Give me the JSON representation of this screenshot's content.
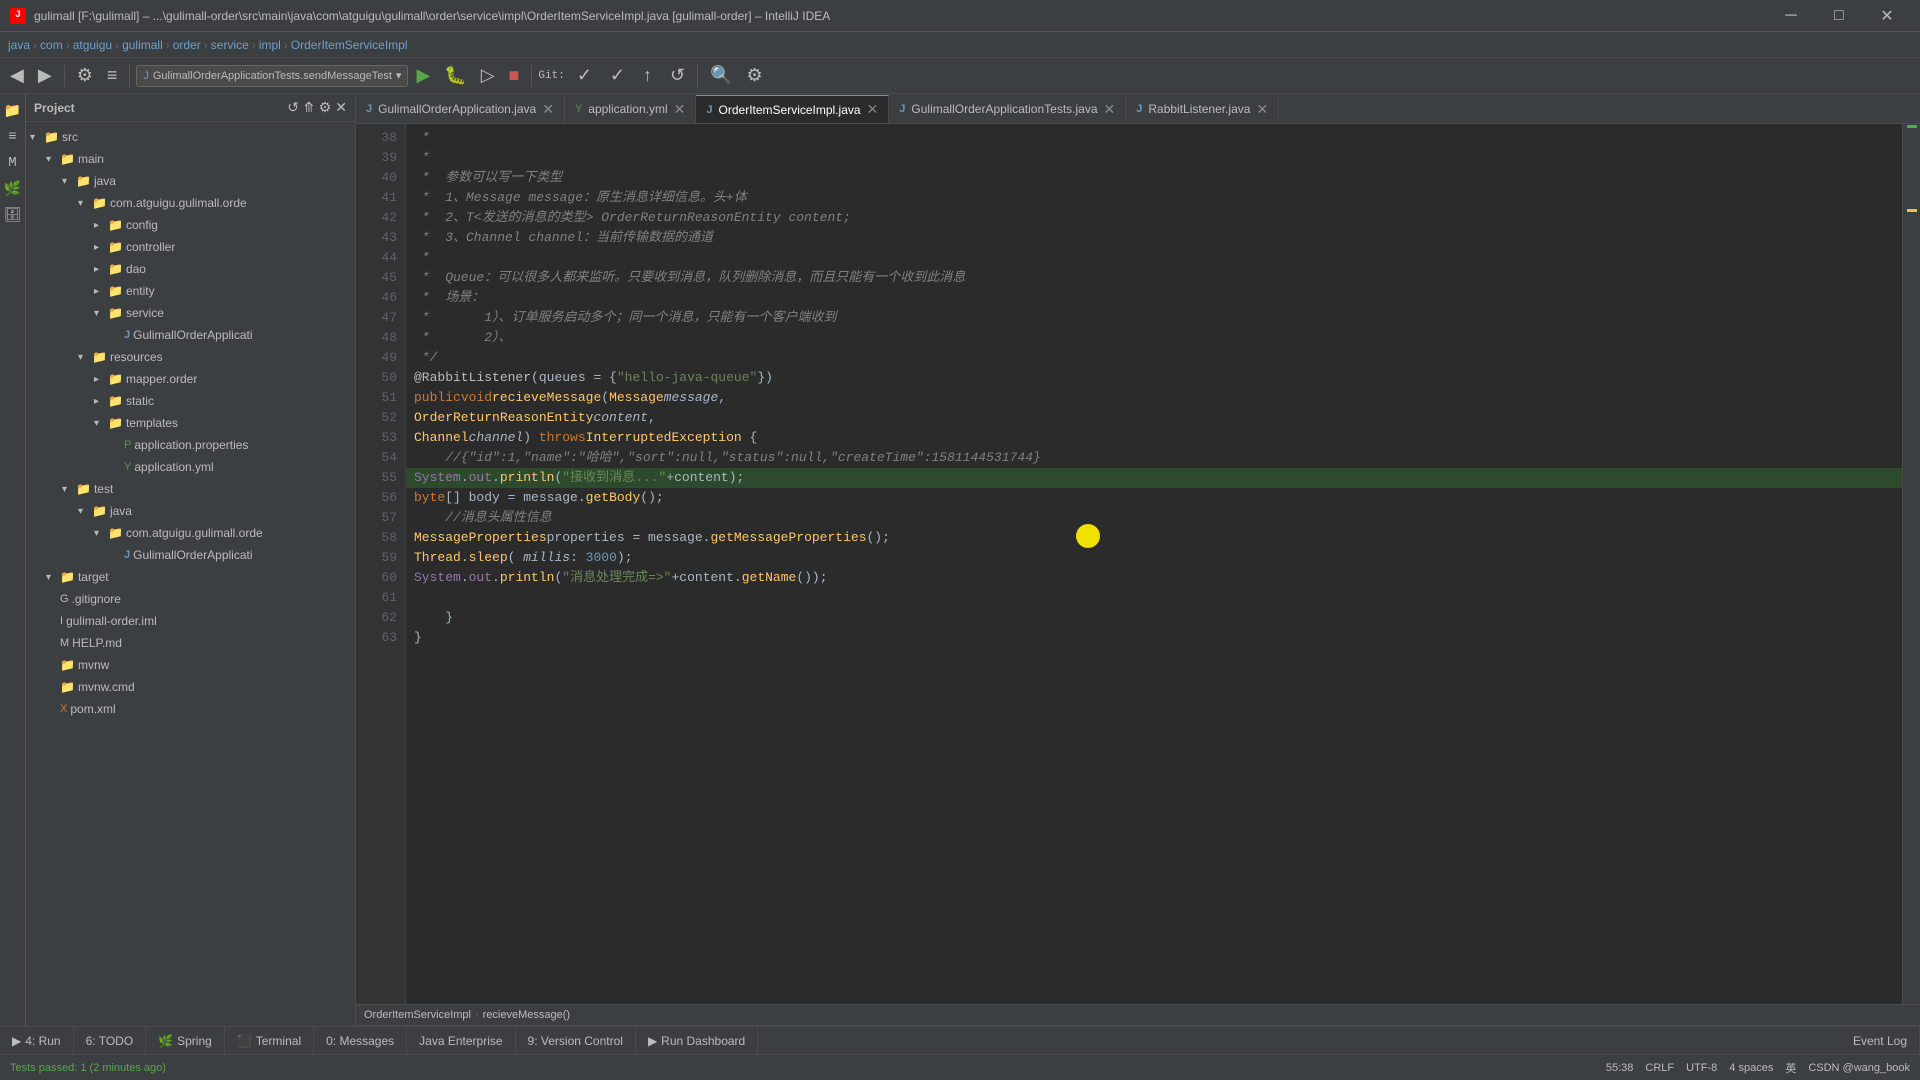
{
  "titlebar": {
    "title": "gulimall [F:\\gulimall] – ...\\gulimall-order\\src\\main\\java\\com\\atguigu\\gulimall\\order\\service\\impl\\OrderItemServiceImpl.java [gulimall-order] – IntelliJ IDEA",
    "minimize": "─",
    "maximize": "□",
    "close": "✕"
  },
  "breadcrumb": {
    "items": [
      "java",
      "com",
      "atguigu",
      "gulimall",
      "order",
      "service",
      "impl",
      "OrderItemServiceImpl"
    ]
  },
  "tabs": [
    {
      "label": "GulimallOrderApplication.java",
      "type": "java",
      "active": false
    },
    {
      "label": "application.yml",
      "type": "yml",
      "active": false
    },
    {
      "label": "OrderItemServiceImpl.java",
      "type": "java",
      "active": true
    },
    {
      "label": "GulimallOrderApplicationTests.java",
      "type": "java",
      "active": false
    },
    {
      "label": "RabbitListener.java",
      "type": "java",
      "active": false
    }
  ],
  "run_config": "GulimallOrderApplicationTests.sendMessageTest",
  "sidebar": {
    "title": "Project",
    "tree": [
      {
        "indent": 0,
        "type": "arrow-down",
        "icon": "folder",
        "label": "src",
        "color": "src"
      },
      {
        "indent": 1,
        "type": "arrow-down",
        "icon": "folder",
        "label": "main",
        "color": "folder"
      },
      {
        "indent": 2,
        "type": "arrow-down",
        "icon": "folder",
        "label": "java",
        "color": "folder"
      },
      {
        "indent": 3,
        "type": "arrow-down",
        "icon": "folder",
        "label": "com.atguigu.gulimall.orde",
        "color": "folder"
      },
      {
        "indent": 4,
        "type": "arrow-right",
        "icon": "folder",
        "label": "config",
        "color": "folder"
      },
      {
        "indent": 4,
        "type": "arrow-right",
        "icon": "folder",
        "label": "controller",
        "color": "folder"
      },
      {
        "indent": 4,
        "type": "arrow-right",
        "icon": "folder",
        "label": "dao",
        "color": "folder"
      },
      {
        "indent": 4,
        "type": "arrow-right",
        "icon": "folder",
        "label": "entity",
        "color": "folder"
      },
      {
        "indent": 4,
        "type": "arrow-down",
        "icon": "folder",
        "label": "service",
        "color": "folder"
      },
      {
        "indent": 5,
        "type": "file",
        "icon": "java",
        "label": "GulimallOrderApplicati",
        "color": "java"
      },
      {
        "indent": 3,
        "type": "arrow-down",
        "icon": "folder",
        "label": "resources",
        "color": "folder"
      },
      {
        "indent": 4,
        "type": "arrow-right",
        "icon": "folder",
        "label": "mapper.order",
        "color": "folder"
      },
      {
        "indent": 4,
        "type": "arrow-right",
        "icon": "folder",
        "label": "static",
        "color": "folder"
      },
      {
        "indent": 4,
        "type": "arrow-down",
        "icon": "folder",
        "label": "templates",
        "color": "folder"
      },
      {
        "indent": 5,
        "type": "file",
        "icon": "properties",
        "label": "application.properties",
        "color": "xml"
      },
      {
        "indent": 5,
        "type": "file",
        "icon": "yml",
        "label": "application.yml",
        "color": "yml"
      },
      {
        "indent": 2,
        "type": "arrow-down",
        "icon": "folder",
        "label": "test",
        "color": "folder"
      },
      {
        "indent": 3,
        "type": "arrow-down",
        "icon": "folder",
        "label": "java",
        "color": "folder"
      },
      {
        "indent": 4,
        "type": "arrow-down",
        "icon": "folder",
        "label": "com.atguigu.gulimall.orde",
        "color": "folder"
      },
      {
        "indent": 5,
        "type": "file",
        "icon": "java",
        "label": "GulimallOrderApplicati",
        "color": "java"
      },
      {
        "indent": 1,
        "type": "arrow-down",
        "icon": "folder",
        "label": "target",
        "color": "folder"
      },
      {
        "indent": 1,
        "type": "file",
        "icon": "git",
        "label": ".gitignore",
        "color": "xml"
      },
      {
        "indent": 1,
        "type": "file",
        "icon": "iml",
        "label": "gulimall-order.iml",
        "color": "iml"
      },
      {
        "indent": 1,
        "type": "file",
        "icon": "md",
        "label": "HELP.md",
        "color": "md"
      },
      {
        "indent": 1,
        "type": "file",
        "icon": "folder",
        "label": "mvnw",
        "color": "folder"
      },
      {
        "indent": 1,
        "type": "file",
        "icon": "folder",
        "label": "mvnw.cmd",
        "color": "folder"
      },
      {
        "indent": 1,
        "type": "file",
        "icon": "xml",
        "label": "pom.xml",
        "color": "xml"
      }
    ]
  },
  "code": {
    "lines": [
      {
        "num": 38,
        "content": " * "
      },
      {
        "num": 39,
        "content": " * "
      },
      {
        "num": 40,
        "content": " *  参数可以写一下类型"
      },
      {
        "num": 41,
        "content": " *  1、Message message：原生消息详细信息。头+体"
      },
      {
        "num": 42,
        "content": " *  2、T<发送的消息的类型> OrderReturnReasonEntity content;"
      },
      {
        "num": 43,
        "content": " *  3、Channel channel：当前传输数据的通道"
      },
      {
        "num": 44,
        "content": " * "
      },
      {
        "num": 45,
        "content": " *  Queue：可以很多人都来监听。只要收到消息，队列删除消息，而且只能有一个收到此消息"
      },
      {
        "num": 46,
        "content": " *  场景："
      },
      {
        "num": 47,
        "content": " *       1）、订单服务启动多个；同一个消息，只能有一个客户端收到"
      },
      {
        "num": 48,
        "content": " *       2）、"
      },
      {
        "num": 49,
        "content": " */"
      },
      {
        "num": 50,
        "content": "@RabbitListener(queues = {\"hello-java-queue\"})"
      },
      {
        "num": 51,
        "content": "public void recieveMessage(Message message,"
      },
      {
        "num": 52,
        "content": "                           OrderReturnReasonEntity content,"
      },
      {
        "num": 53,
        "content": "                           Channel channel) throws InterruptedException {"
      },
      {
        "num": 54,
        "content": "    //{\"id\":1,\"name\":\"哈哈\",\"sort\":null,\"status\":null,\"createTime\":1581144531744}"
      },
      {
        "num": 55,
        "content": "    System.out.println(\"接收到消息...\"+content);",
        "highlight": true
      },
      {
        "num": 56,
        "content": "    byte[] body = message.getBody();"
      },
      {
        "num": 57,
        "content": "    //消息头属性信息"
      },
      {
        "num": 58,
        "content": "    MessageProperties properties = message.getMessageProperties();"
      },
      {
        "num": 59,
        "content": "    Thread.sleep( millis: 3000);"
      },
      {
        "num": 60,
        "content": "    System.out.println(\"消息处理完成=>\"+content.getName());"
      },
      {
        "num": 61,
        "content": ""
      },
      {
        "num": 62,
        "content": "    }"
      },
      {
        "num": 63,
        "content": "}"
      }
    ]
  },
  "editor_breadcrumb": {
    "items": [
      "OrderItemServiceImpl",
      "recieveMessage()"
    ]
  },
  "status": {
    "test_status": "Tests passed: 1 (2 minutes ago)",
    "position": "55:38",
    "line_sep": "CRLF",
    "encoding": "UTF-8",
    "indent": "4 spaces",
    "git": "Git:",
    "lang": "英"
  },
  "bottom_tabs": [
    {
      "label": "4: Run",
      "icon": "▶",
      "active": false
    },
    {
      "label": "6: TODO",
      "icon": "",
      "active": false
    },
    {
      "label": "Spring",
      "icon": "",
      "active": false
    },
    {
      "label": "Terminal",
      "icon": "",
      "active": false
    },
    {
      "label": "0: Messages",
      "icon": "",
      "active": false
    },
    {
      "label": "Java Enterprise",
      "icon": "",
      "active": false
    },
    {
      "label": "9: Version Control",
      "icon": "",
      "active": false
    },
    {
      "label": "Run Dashboard",
      "icon": "",
      "active": false
    },
    {
      "label": "Event Log",
      "icon": "",
      "active": false
    }
  ]
}
